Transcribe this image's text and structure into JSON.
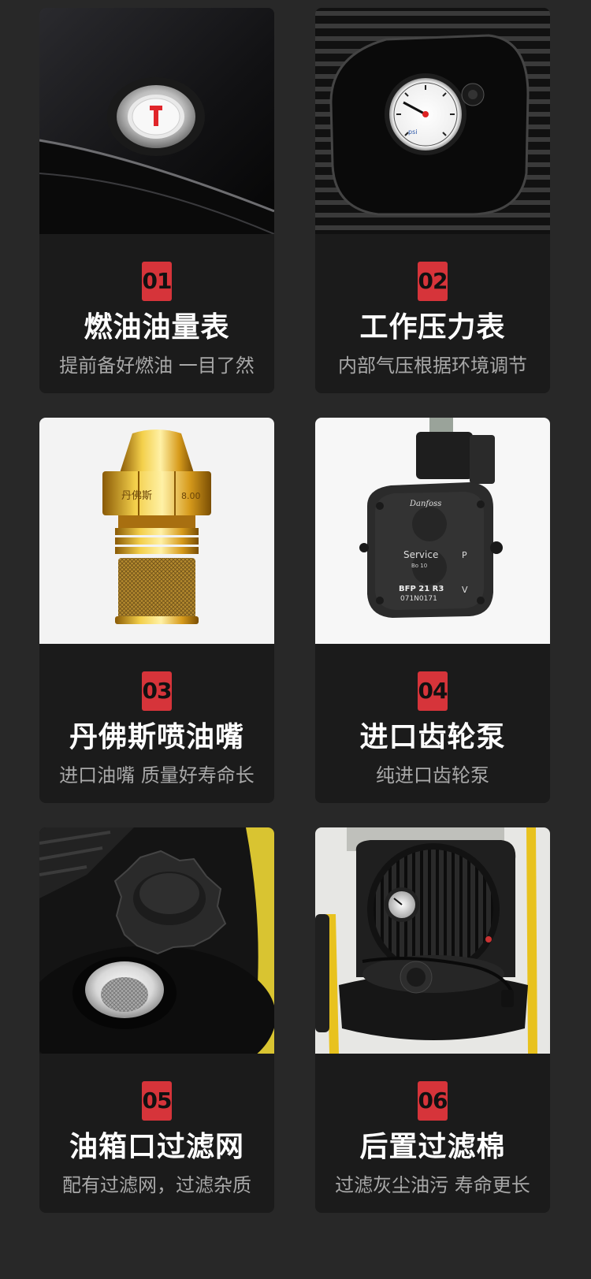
{
  "features": [
    {
      "num": "01",
      "title": "燃油油量表",
      "subtitle": "提前备好燃油 一目了然",
      "image_icon": "fuel-gauge-icon",
      "label_text": ""
    },
    {
      "num": "02",
      "title": "工作压力表",
      "subtitle": "内部气压根据环境调节",
      "image_icon": "pressure-gauge-icon",
      "label_text": ""
    },
    {
      "num": "03",
      "title": "丹佛斯喷油嘴",
      "subtitle": "进口油嘴 质量好寿命长",
      "image_icon": "nozzle-icon",
      "label_text": "丹佛斯",
      "label_value": "8.00"
    },
    {
      "num": "04",
      "title": "进口齿轮泵",
      "subtitle": "纯进口齿轮泵",
      "image_icon": "gear-pump-icon",
      "label_text": "Service",
      "label_sub": "Bo 10",
      "label_model": "BFP 21 R3",
      "label_code": "071N0171",
      "label_brand": "Danfoss",
      "label_p": "P",
      "label_v": "V"
    },
    {
      "num": "05",
      "title": "油箱口过滤网",
      "subtitle": "配有过滤网，过滤杂质",
      "image_icon": "tank-cap-icon",
      "label_text": ""
    },
    {
      "num": "06",
      "title": "后置过滤棉",
      "subtitle": "过滤灰尘油污 寿命更长",
      "image_icon": "rear-filter-icon",
      "label_text": ""
    }
  ],
  "colors": {
    "background": "#282828",
    "card": "#1b1b1b",
    "badge": "#d6343a",
    "title": "#ffffff",
    "subtitle": "#a8a8a8"
  }
}
